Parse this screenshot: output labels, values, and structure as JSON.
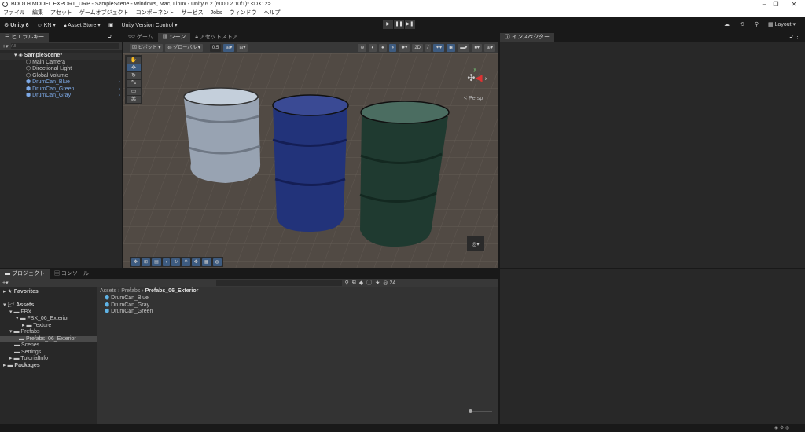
{
  "window": {
    "title": "BOOTH MODEL EXPORT_URP - SampleScene - Windows, Mac, Linux - Unity 6.2 (6000.2.10f1)* <DX12>"
  },
  "menu": [
    "ファイル",
    "編集",
    "アセット",
    "ゲームオブジェクト",
    "コンポーネント",
    "サービス",
    "Jobs",
    "ウィンドウ",
    "ヘルプ"
  ],
  "toolbar": {
    "unity": "Unity 6",
    "account": "KN",
    "asset_store": "Asset Store",
    "version_control": "Unity Version Control",
    "layout": "Layout"
  },
  "hierarchy": {
    "tab": "ヒエラルキー",
    "search_placeholder": "All",
    "scene": "SampleScene*",
    "items": [
      "Main Camera",
      "Directional Light",
      "Global Volume",
      "DrumCan_Blue",
      "DrumCan_Green",
      "DrumCan_Gray"
    ]
  },
  "scene_tabs": [
    "ゲーム",
    "シーン",
    "アセットストア"
  ],
  "scene_toolbar": {
    "pivot": "ピボット",
    "global": "グローバル",
    "snap": "0.5"
  },
  "gizmo": {
    "y": "y",
    "x": "x",
    "persp": "< Persp"
  },
  "inspector": {
    "tab": "インスペクター"
  },
  "project": {
    "tabs": [
      "プロジェクト",
      "コンソール"
    ],
    "favorites": "Favorites",
    "tree": [
      "Assets",
      "FBX",
      "FBX_06_Exterior",
      "Texture",
      "Prefabs",
      "Prefabs_06_Exterior",
      "Scenes",
      "Settings",
      "TutorialInfo",
      "Packages"
    ],
    "breadcrumb": [
      "Assets",
      "Prefabs",
      "Prefabs_06_Exterior"
    ],
    "files": [
      "DrumCan_Blue",
      "DrumCan_Gray",
      "DrumCan_Green"
    ],
    "count": "24"
  }
}
